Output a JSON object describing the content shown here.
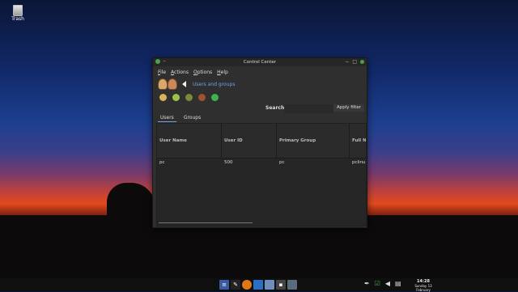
{
  "desktop": {
    "trash_label": "Trash"
  },
  "window": {
    "title": "Control Center",
    "menu": [
      "File",
      "Actions",
      "Options",
      "Help"
    ],
    "header_title": "Users and groups",
    "search_label": "Search:",
    "filter_button": "Apply filter",
    "tabs": [
      "Users",
      "Groups"
    ],
    "columns": [
      "User Name",
      "User ID",
      "Primary Group",
      "Full N"
    ],
    "rows": [
      {
        "user_name": "pc",
        "user_id": "500",
        "primary_group": "pc",
        "full_name": "pclinux"
      }
    ]
  },
  "toolbar_icons": [
    "add-user-icon",
    "add-group-icon",
    "edit-icon",
    "delete-icon",
    "refresh-icon"
  ],
  "taskbar": {
    "launchers": [
      "menu-icon",
      "brush-icon",
      "firefox-icon",
      "thunderbird-icon",
      "files-icon",
      "terminal-icon",
      "control-center-icon"
    ],
    "time": "14:28",
    "date": "Sunday 13 February"
  },
  "colors": {
    "accent": "#6ea3e6",
    "window_bg": "#2f2f2f",
    "taskbar_bg": "#0f0f0f"
  }
}
